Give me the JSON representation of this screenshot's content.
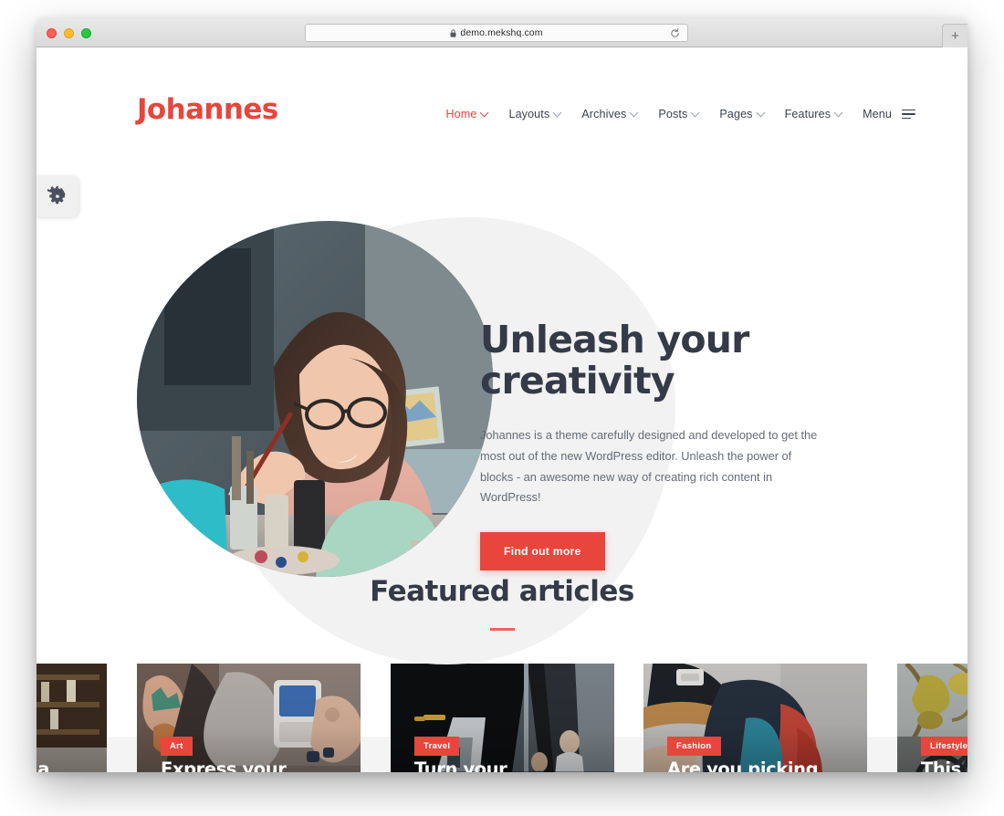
{
  "browser": {
    "url": "demo.mekshq.com",
    "lock_icon": "lock-icon",
    "reload_icon": "reload-icon",
    "new_tab_label": "+",
    "traffic_lights": [
      "close",
      "minimize",
      "zoom"
    ]
  },
  "site": {
    "logo": "Johannes",
    "nav": [
      {
        "label": "Home",
        "active": true,
        "has_dropdown": true
      },
      {
        "label": "Layouts",
        "active": false,
        "has_dropdown": true
      },
      {
        "label": "Archives",
        "active": false,
        "has_dropdown": true
      },
      {
        "label": "Posts",
        "active": false,
        "has_dropdown": true
      },
      {
        "label": "Pages",
        "active": false,
        "has_dropdown": true
      },
      {
        "label": "Features",
        "active": false,
        "has_dropdown": true
      },
      {
        "label": "Menu",
        "active": false,
        "has_dropdown": false
      }
    ],
    "settings_tab_icon": "gear-icon"
  },
  "hero": {
    "title_line1": "Unleash your",
    "title_line2": "creativity",
    "paragraph": "Johannes is a theme carefully designed and developed to get the most out of the new WordPress editor. Unleash the power of blocks - an awesome new way of creating rich content in WordPress!",
    "cta_label": "Find out more",
    "image_alt": "woman-painting-photo"
  },
  "featured": {
    "heading": "Featured articles"
  },
  "cards": [
    {
      "category": "",
      "title": "m a",
      "theme": "bar-shelves"
    },
    {
      "category": "Art",
      "title": "Express your",
      "theme": "tattoo-coffee"
    },
    {
      "category": "Travel",
      "title": "Turn your commute into a",
      "theme": "train-station"
    },
    {
      "category": "Fashion",
      "title": "Are you picking",
      "theme": "cap-jacket"
    },
    {
      "category": "Lifestyle",
      "title": "This i",
      "theme": "bicycle-autumn"
    }
  ],
  "colors": {
    "brand_red": "#e8453c",
    "heading_navy": "#343a47",
    "body_grey": "#646b78",
    "blob_grey": "#f2f2f2",
    "band_grey": "#f4f4f4"
  }
}
